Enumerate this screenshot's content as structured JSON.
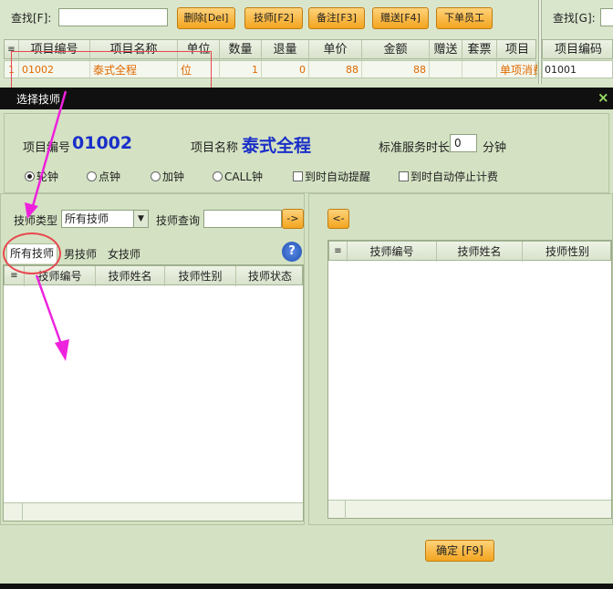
{
  "top": {
    "search_label": "查找[F]:",
    "search_value": "",
    "buttons": [
      "删除[Del]",
      "技师[F2]",
      "备注[F3]",
      "赠送[F4]",
      "下单员工"
    ],
    "right_search_label": "查找[G]:",
    "right_search_value": "",
    "columns": [
      "项目编号",
      "项目名称",
      "单位",
      "数量",
      "退量",
      "单价",
      "金额",
      "赠送",
      "套票",
      "项目"
    ],
    "row": {
      "index": "1",
      "code": "01002",
      "name": "泰式全程",
      "unit": "位",
      "qty": "1",
      "return_qty": "0",
      "price": "88",
      "amount": "88",
      "gift": "",
      "ticket": "",
      "project": "单项消费"
    },
    "right_columns": [
      "项目编码"
    ],
    "right_row": [
      "01001"
    ]
  },
  "dialog": {
    "title": "选择技师",
    "close": "×",
    "item_code_label": "项目编号",
    "item_code": "01002",
    "item_name_label": "项目名称",
    "item_name": "泰式全程",
    "std_time_label": "标准服务时长",
    "std_time_value": "0",
    "std_time_unit": "分钟",
    "clock_options": [
      "轮钟",
      "点钟",
      "加钟",
      "CALL钟"
    ],
    "clock_selected": "轮钟",
    "checkboxes": [
      "到时自动提醒",
      "到时自动停止计费"
    ],
    "tech_type_label": "技师类型",
    "tech_type_value": "所有技师",
    "tech_query_label": "技师查询",
    "tech_query_value": "",
    "arrow_right": "->",
    "arrow_left": "<-",
    "tabs": [
      "所有技师",
      "男技师",
      "女技师"
    ],
    "help": "?",
    "left_columns": [
      "技师编号",
      "技师姓名",
      "技师性别",
      "技师状态"
    ],
    "right_columns": [
      "技师编号",
      "技师姓名",
      "技师性别"
    ],
    "confirm": "确定 [F9]"
  },
  "colors": {
    "accent_orange": "#f2a520",
    "highlight_red": "#e8474f",
    "arrow_magenta": "#ee22dd",
    "title_bar": "#101010",
    "code_blue": "#1a2fc8"
  }
}
